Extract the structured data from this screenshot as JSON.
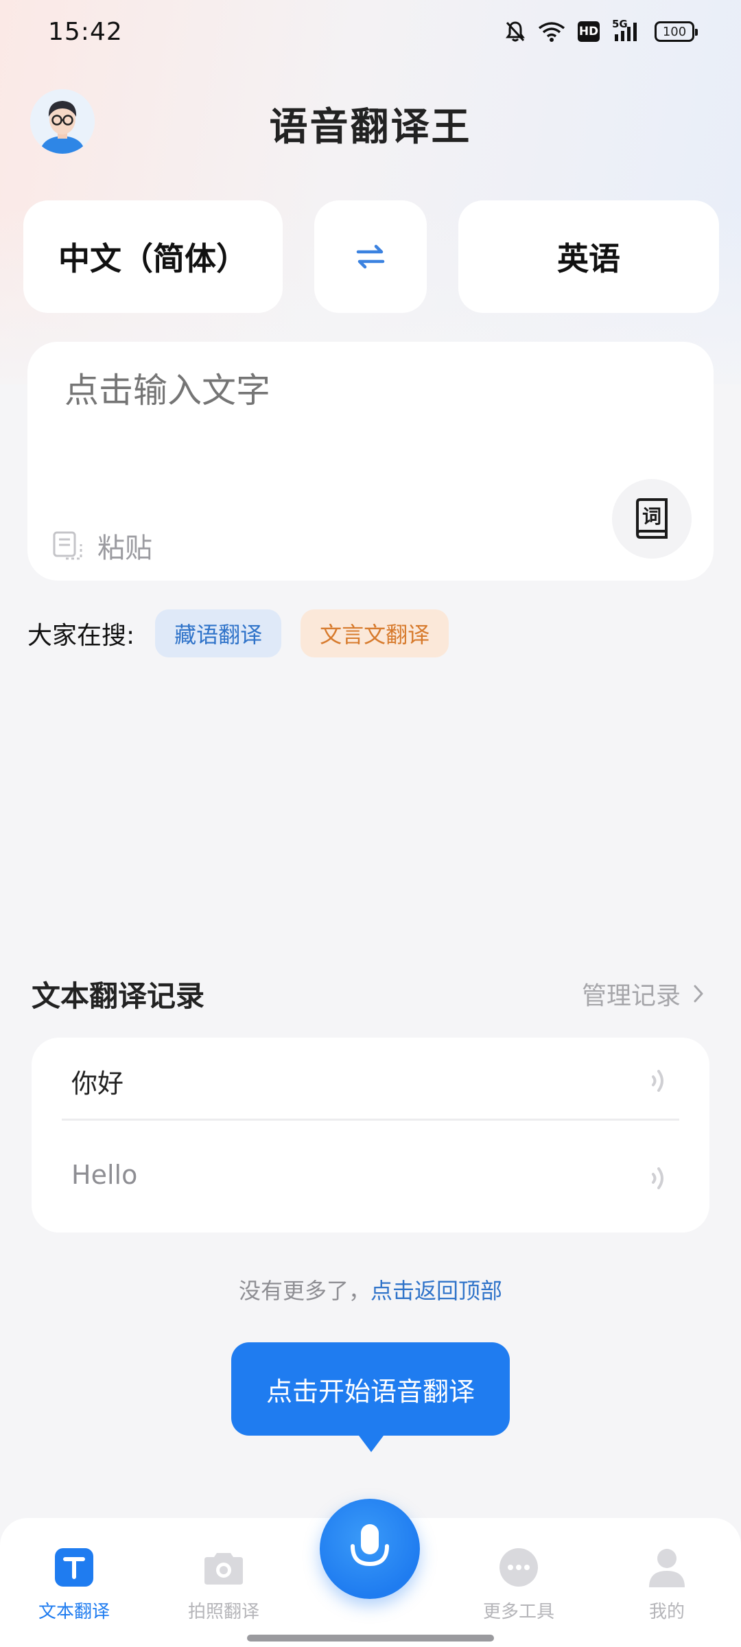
{
  "status_bar": {
    "time": "15:42",
    "signal_label": "5G",
    "hd_label": "HD",
    "battery": "100"
  },
  "header": {
    "title": "语音翻译王",
    "avatar_icon": "user-avatar-icon"
  },
  "languages": {
    "source": "中文（简体）",
    "target": "英语",
    "swap_icon": "swap-arrows-icon"
  },
  "input": {
    "placeholder": "点击输入文字",
    "paste_label": "粘贴",
    "dictionary_icon_char": "词"
  },
  "hot_search": {
    "label": "大家在搜:",
    "chips": [
      "藏语翻译",
      "文言文翻译"
    ]
  },
  "history": {
    "title": "文本翻译记录",
    "manage_label": "管理记录",
    "items": [
      {
        "text": "你好"
      },
      {
        "text": "Hello"
      }
    ]
  },
  "footer_note": {
    "prefix": "没有更多了，",
    "link": "点击返回顶部"
  },
  "voice_tooltip": "点击开始语音翻译",
  "bottom_nav": {
    "items": [
      {
        "label": "文本翻译",
        "icon": "text-translate-icon",
        "active": true
      },
      {
        "label": "拍照翻译",
        "icon": "camera-icon",
        "active": false
      },
      {
        "label": "更多工具",
        "icon": "more-dots-icon",
        "active": false
      },
      {
        "label": "我的",
        "icon": "profile-icon",
        "active": false
      }
    ],
    "center_icon": "microphone-icon"
  },
  "colors": {
    "accent": "#1f7cf0",
    "chip_blue_text": "#2f73c9",
    "chip_orange_text": "#d77a2c",
    "background": "#f5f5f7"
  }
}
